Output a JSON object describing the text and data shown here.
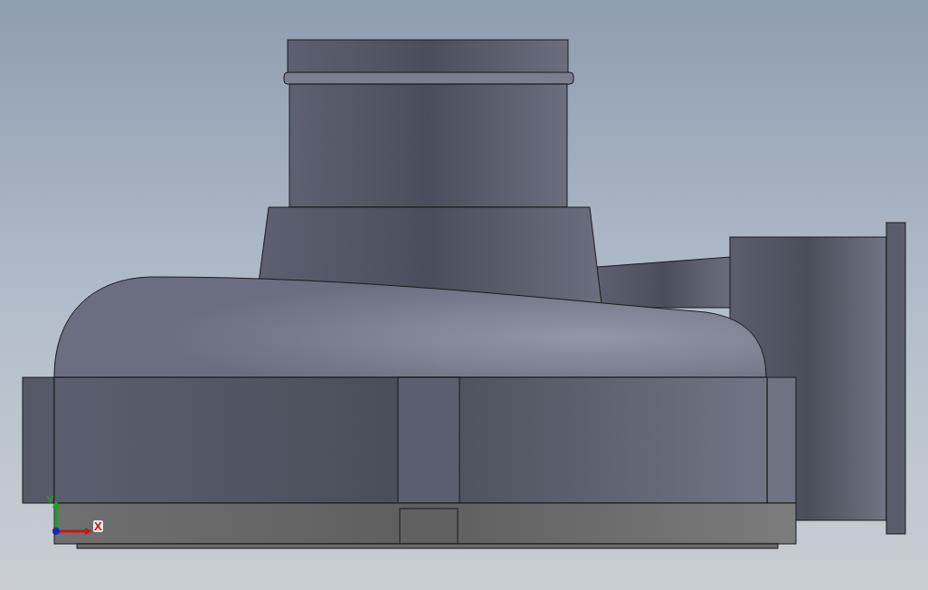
{
  "viewport": {
    "triad": {
      "axes": [
        {
          "label": "Y",
          "kind": "vertical",
          "color": "#1fa01f"
        },
        {
          "label": "X",
          "kind": "horizontal",
          "color": "#c01818"
        }
      ]
    }
  }
}
